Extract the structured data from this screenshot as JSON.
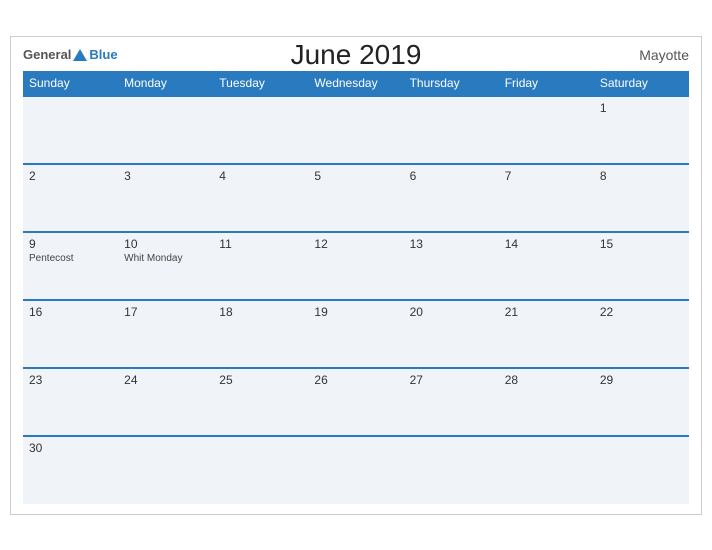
{
  "header": {
    "logo_general": "General",
    "logo_blue": "Blue",
    "title": "June 2019",
    "region": "Mayotte"
  },
  "days_of_week": [
    "Sunday",
    "Monday",
    "Tuesday",
    "Wednesday",
    "Thursday",
    "Friday",
    "Saturday"
  ],
  "weeks": [
    [
      {
        "day": "",
        "event": ""
      },
      {
        "day": "",
        "event": ""
      },
      {
        "day": "",
        "event": ""
      },
      {
        "day": "",
        "event": ""
      },
      {
        "day": "",
        "event": ""
      },
      {
        "day": "",
        "event": ""
      },
      {
        "day": "1",
        "event": ""
      }
    ],
    [
      {
        "day": "2",
        "event": ""
      },
      {
        "day": "3",
        "event": ""
      },
      {
        "day": "4",
        "event": ""
      },
      {
        "day": "5",
        "event": ""
      },
      {
        "day": "6",
        "event": ""
      },
      {
        "day": "7",
        "event": ""
      },
      {
        "day": "8",
        "event": ""
      }
    ],
    [
      {
        "day": "9",
        "event": "Pentecost"
      },
      {
        "day": "10",
        "event": "Whit Monday"
      },
      {
        "day": "11",
        "event": ""
      },
      {
        "day": "12",
        "event": ""
      },
      {
        "day": "13",
        "event": ""
      },
      {
        "day": "14",
        "event": ""
      },
      {
        "day": "15",
        "event": ""
      }
    ],
    [
      {
        "day": "16",
        "event": ""
      },
      {
        "day": "17",
        "event": ""
      },
      {
        "day": "18",
        "event": ""
      },
      {
        "day": "19",
        "event": ""
      },
      {
        "day": "20",
        "event": ""
      },
      {
        "day": "21",
        "event": ""
      },
      {
        "day": "22",
        "event": ""
      }
    ],
    [
      {
        "day": "23",
        "event": ""
      },
      {
        "day": "24",
        "event": ""
      },
      {
        "day": "25",
        "event": ""
      },
      {
        "day": "26",
        "event": ""
      },
      {
        "day": "27",
        "event": ""
      },
      {
        "day": "28",
        "event": ""
      },
      {
        "day": "29",
        "event": ""
      }
    ],
    [
      {
        "day": "30",
        "event": ""
      },
      {
        "day": "",
        "event": ""
      },
      {
        "day": "",
        "event": ""
      },
      {
        "day": "",
        "event": ""
      },
      {
        "day": "",
        "event": ""
      },
      {
        "day": "",
        "event": ""
      },
      {
        "day": "",
        "event": ""
      }
    ]
  ]
}
